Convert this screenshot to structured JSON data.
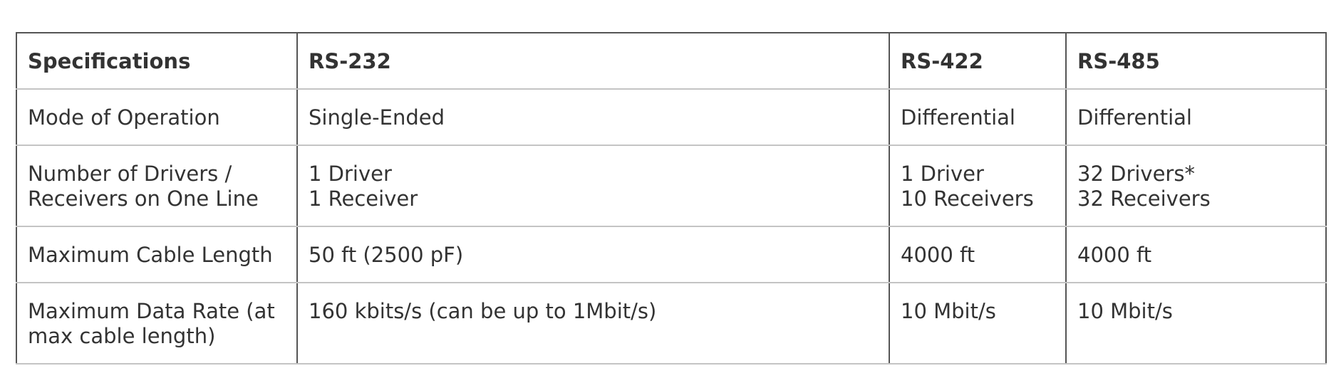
{
  "table": {
    "headers": [
      "Specifications",
      "RS-232",
      "RS-422",
      "RS-485"
    ],
    "rows": [
      {
        "label": "Mode of Operation",
        "rs232": "Single-Ended",
        "rs422": "Differential",
        "rs485": "Differential"
      },
      {
        "label": "Number of Drivers /\nReceivers on One Line",
        "rs232": "1 Driver\n1 Receiver",
        "rs422": "1 Driver\n10 Receivers",
        "rs485": "32 Drivers*\n32 Receivers"
      },
      {
        "label": "Maximum Cable Length",
        "rs232": "50 ft (2500 pF)",
        "rs422": "4000 ft",
        "rs485": "4000 ft"
      },
      {
        "label": "Maximum Data Rate (at\nmax cable length)",
        "rs232": "160 kbits/s (can be up to 1Mbit/s)",
        "rs422": "10 Mbit/s",
        "rs485": "10 Mbit/s"
      }
    ]
  }
}
